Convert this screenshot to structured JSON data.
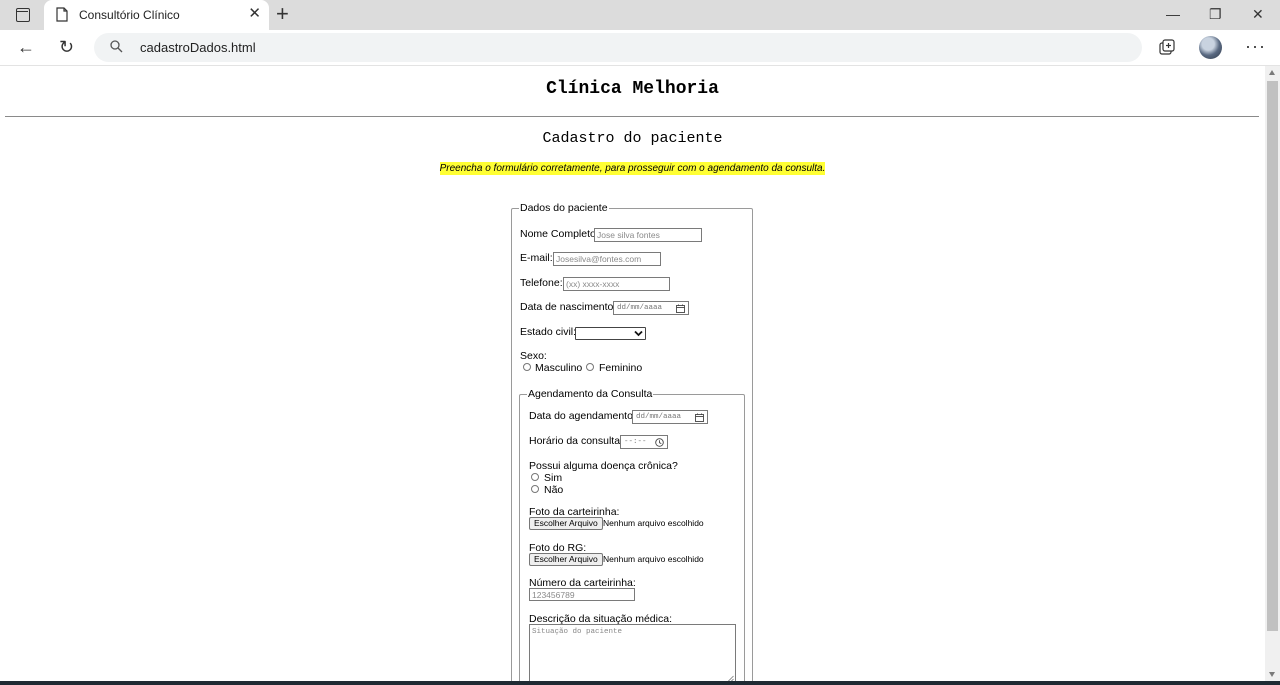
{
  "browser": {
    "tab_title": "Consultório Clínico",
    "tab_close": "✕",
    "new_tab": "+",
    "url": "cadastroDados.html",
    "win_minimize": "—",
    "win_restore": "❐",
    "win_close": "✕",
    "back": "←",
    "refresh": "↻",
    "more": "···"
  },
  "page": {
    "site_title": "Clínica Melhoria",
    "subtitle": "Cadastro do paciente",
    "notice": "Preencha o formulário corretamente, para prosseguir com o agendamento da consulta."
  },
  "patient": {
    "legend": "Dados do paciente",
    "name_label": "Nome Completo:",
    "name_placeholder": "Jose silva fontes",
    "email_label": "E-mail:",
    "email_placeholder": "Josesilva@fontes.com",
    "phone_label": "Telefone:",
    "phone_placeholder": "(xx) xxxx-xxxx",
    "birth_label": "Data de nascimento:",
    "birth_placeholder": "dd/mm/aaaa",
    "civil_label": "Estado civil:",
    "civil_value": "",
    "sex_label": "Sexo:",
    "sex_options": [
      "Masculino",
      "Feminino"
    ]
  },
  "appointment": {
    "legend": "Agendamento da Consulta",
    "date_label": "Data do agendamento:",
    "date_placeholder": "dd/mm/aaaa",
    "time_label": "Horário da consulta:",
    "time_placeholder": "--:--",
    "chronic_label": "Possui alguma doença crônica?",
    "chronic_options": [
      "Sim",
      "Não"
    ],
    "card_photo_label": "Foto da carteirinha:",
    "rg_photo_label": "Foto do RG:",
    "file_button": "Escolher Arquivo",
    "file_status": "Nenhum arquivo escolhido",
    "card_number_label": "Número da carteirinha:",
    "card_number_placeholder": "123456789",
    "description_label": "Descrição da situação médica:",
    "description_placeholder": "Situação do paciente"
  }
}
